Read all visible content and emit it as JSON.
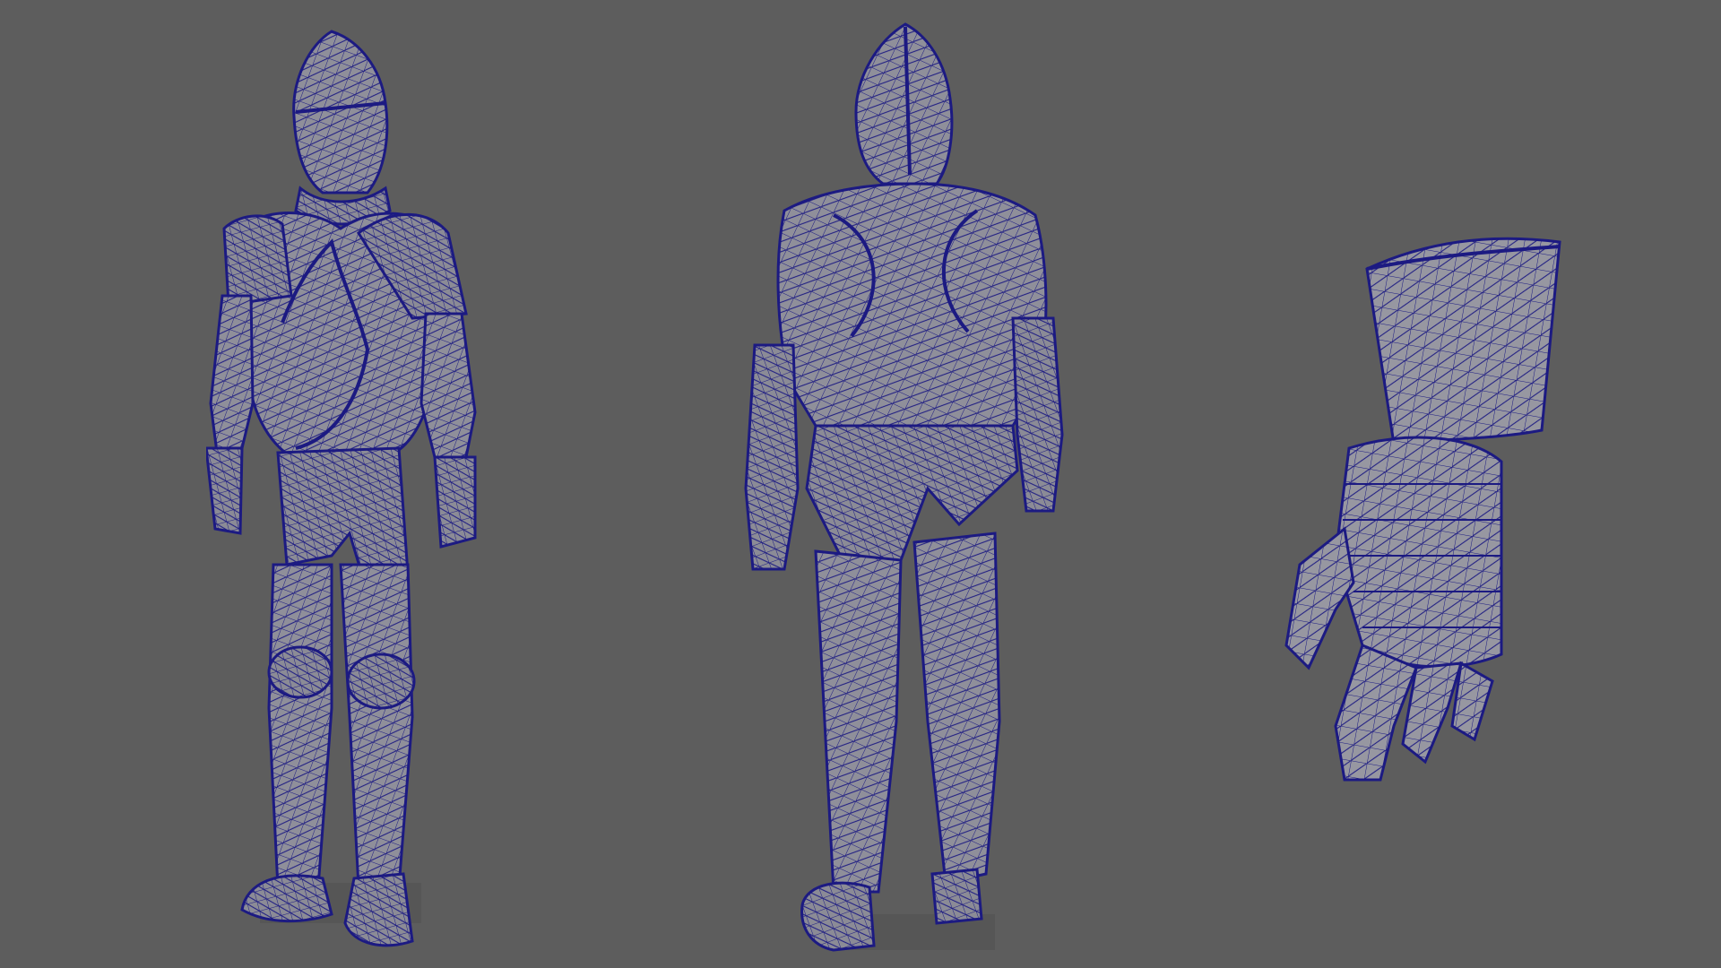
{
  "viewport": {
    "background_color": "#5d5d5d",
    "shading": "wireframe-on-shaded",
    "wire_color": "#1c1a82",
    "surface_color": "#8e8e98"
  },
  "models": [
    {
      "name": "armor-suit-front",
      "view": "front-three-quarter"
    },
    {
      "name": "armor-suit-back",
      "view": "back-three-quarter"
    },
    {
      "name": "gauntlet",
      "view": "detail"
    }
  ]
}
